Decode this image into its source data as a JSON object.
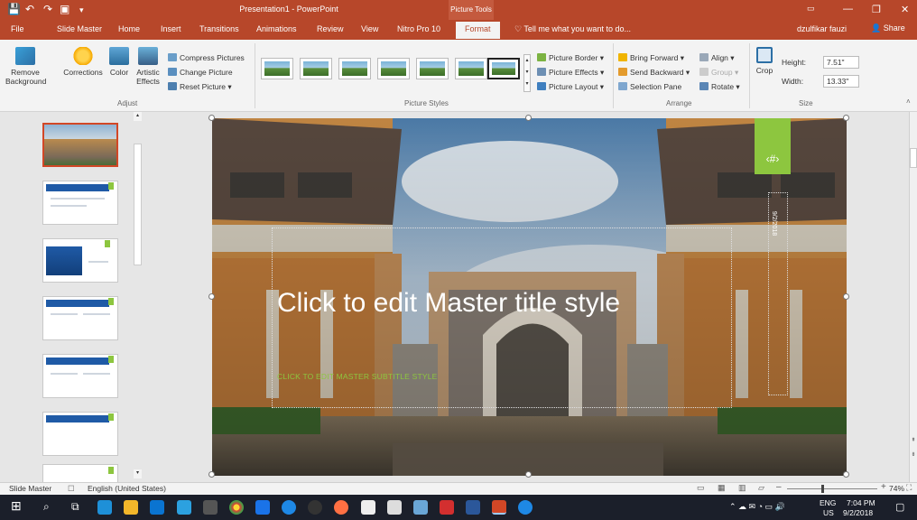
{
  "titlebar": {
    "title": "Presentation1 - PowerPoint",
    "context_tab": "Picture Tools"
  },
  "tabs": [
    {
      "label": "File"
    },
    {
      "label": "Slide Master"
    },
    {
      "label": "Home"
    },
    {
      "label": "Insert"
    },
    {
      "label": "Transitions"
    },
    {
      "label": "Animations"
    },
    {
      "label": "Review"
    },
    {
      "label": "View"
    },
    {
      "label": "Nitro Pro 10"
    },
    {
      "label": "Format"
    }
  ],
  "tellme": "Tell me what you want to do...",
  "user": "dzulfikar fauzi",
  "share": "Share",
  "ribbon": {
    "adjust": {
      "remove_bg": "Remove Background",
      "corrections": "Corrections",
      "color": "Color",
      "artistic": "Artistic Effects",
      "compress": "Compress Pictures",
      "change": "Change Picture",
      "reset": "Reset Picture",
      "group_label": "Adjust"
    },
    "styles": {
      "border": "Picture Border",
      "effects": "Picture Effects",
      "layout": "Picture Layout",
      "group_label": "Picture Styles"
    },
    "arrange": {
      "forward": "Bring Forward",
      "backward": "Send Backward",
      "selection": "Selection Pane",
      "align": "Align",
      "group": "Group",
      "rotate": "Rotate",
      "group_label": "Arrange"
    },
    "size": {
      "crop": "Crop",
      "height_label": "Height:",
      "height_value": "7.51\"",
      "width_label": "Width:",
      "width_value": "13.33\"",
      "group_label": "Size"
    }
  },
  "slide": {
    "title": "Click to edit Master title style",
    "subtitle": "CLICK TO EDIT MASTER SUBTITLE STYLE",
    "number": "‹#›",
    "date": "9/2/2018"
  },
  "thumb_text": {
    "master": "Click to edit Master title style"
  },
  "status": {
    "view": "Slide Master",
    "language": "English (United States)",
    "zoom": "74%"
  },
  "taskbar": {
    "lang": "ENG",
    "region": "US",
    "time": "7:04 PM",
    "date": "9/2/2018"
  },
  "colors": {
    "accent": "#b7472a",
    "green": "#8dc63f",
    "blue": "#1f5aa6"
  }
}
